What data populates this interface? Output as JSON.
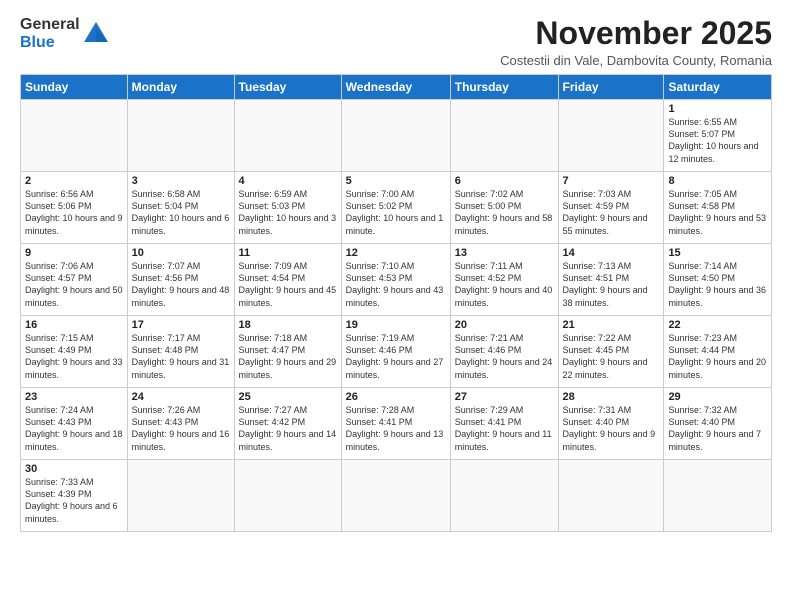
{
  "logo": {
    "text_general": "General",
    "text_blue": "Blue"
  },
  "header": {
    "month_title": "November 2025",
    "subtitle": "Costestii din Vale, Dambovita County, Romania"
  },
  "days_of_week": [
    "Sunday",
    "Monday",
    "Tuesday",
    "Wednesday",
    "Thursday",
    "Friday",
    "Saturday"
  ],
  "weeks": [
    [
      {
        "day": "",
        "info": ""
      },
      {
        "day": "",
        "info": ""
      },
      {
        "day": "",
        "info": ""
      },
      {
        "day": "",
        "info": ""
      },
      {
        "day": "",
        "info": ""
      },
      {
        "day": "",
        "info": ""
      },
      {
        "day": "1",
        "info": "Sunrise: 6:55 AM\nSunset: 5:07 PM\nDaylight: 10 hours and 12 minutes."
      }
    ],
    [
      {
        "day": "2",
        "info": "Sunrise: 6:56 AM\nSunset: 5:06 PM\nDaylight: 10 hours and 9 minutes."
      },
      {
        "day": "3",
        "info": "Sunrise: 6:58 AM\nSunset: 5:04 PM\nDaylight: 10 hours and 6 minutes."
      },
      {
        "day": "4",
        "info": "Sunrise: 6:59 AM\nSunset: 5:03 PM\nDaylight: 10 hours and 3 minutes."
      },
      {
        "day": "5",
        "info": "Sunrise: 7:00 AM\nSunset: 5:02 PM\nDaylight: 10 hours and 1 minute."
      },
      {
        "day": "6",
        "info": "Sunrise: 7:02 AM\nSunset: 5:00 PM\nDaylight: 9 hours and 58 minutes."
      },
      {
        "day": "7",
        "info": "Sunrise: 7:03 AM\nSunset: 4:59 PM\nDaylight: 9 hours and 55 minutes."
      },
      {
        "day": "8",
        "info": "Sunrise: 7:05 AM\nSunset: 4:58 PM\nDaylight: 9 hours and 53 minutes."
      }
    ],
    [
      {
        "day": "9",
        "info": "Sunrise: 7:06 AM\nSunset: 4:57 PM\nDaylight: 9 hours and 50 minutes."
      },
      {
        "day": "10",
        "info": "Sunrise: 7:07 AM\nSunset: 4:56 PM\nDaylight: 9 hours and 48 minutes."
      },
      {
        "day": "11",
        "info": "Sunrise: 7:09 AM\nSunset: 4:54 PM\nDaylight: 9 hours and 45 minutes."
      },
      {
        "day": "12",
        "info": "Sunrise: 7:10 AM\nSunset: 4:53 PM\nDaylight: 9 hours and 43 minutes."
      },
      {
        "day": "13",
        "info": "Sunrise: 7:11 AM\nSunset: 4:52 PM\nDaylight: 9 hours and 40 minutes."
      },
      {
        "day": "14",
        "info": "Sunrise: 7:13 AM\nSunset: 4:51 PM\nDaylight: 9 hours and 38 minutes."
      },
      {
        "day": "15",
        "info": "Sunrise: 7:14 AM\nSunset: 4:50 PM\nDaylight: 9 hours and 36 minutes."
      }
    ],
    [
      {
        "day": "16",
        "info": "Sunrise: 7:15 AM\nSunset: 4:49 PM\nDaylight: 9 hours and 33 minutes."
      },
      {
        "day": "17",
        "info": "Sunrise: 7:17 AM\nSunset: 4:48 PM\nDaylight: 9 hours and 31 minutes."
      },
      {
        "day": "18",
        "info": "Sunrise: 7:18 AM\nSunset: 4:47 PM\nDaylight: 9 hours and 29 minutes."
      },
      {
        "day": "19",
        "info": "Sunrise: 7:19 AM\nSunset: 4:46 PM\nDaylight: 9 hours and 27 minutes."
      },
      {
        "day": "20",
        "info": "Sunrise: 7:21 AM\nSunset: 4:46 PM\nDaylight: 9 hours and 24 minutes."
      },
      {
        "day": "21",
        "info": "Sunrise: 7:22 AM\nSunset: 4:45 PM\nDaylight: 9 hours and 22 minutes."
      },
      {
        "day": "22",
        "info": "Sunrise: 7:23 AM\nSunset: 4:44 PM\nDaylight: 9 hours and 20 minutes."
      }
    ],
    [
      {
        "day": "23",
        "info": "Sunrise: 7:24 AM\nSunset: 4:43 PM\nDaylight: 9 hours and 18 minutes."
      },
      {
        "day": "24",
        "info": "Sunrise: 7:26 AM\nSunset: 4:43 PM\nDaylight: 9 hours and 16 minutes."
      },
      {
        "day": "25",
        "info": "Sunrise: 7:27 AM\nSunset: 4:42 PM\nDaylight: 9 hours and 14 minutes."
      },
      {
        "day": "26",
        "info": "Sunrise: 7:28 AM\nSunset: 4:41 PM\nDaylight: 9 hours and 13 minutes."
      },
      {
        "day": "27",
        "info": "Sunrise: 7:29 AM\nSunset: 4:41 PM\nDaylight: 9 hours and 11 minutes."
      },
      {
        "day": "28",
        "info": "Sunrise: 7:31 AM\nSunset: 4:40 PM\nDaylight: 9 hours and 9 minutes."
      },
      {
        "day": "29",
        "info": "Sunrise: 7:32 AM\nSunset: 4:40 PM\nDaylight: 9 hours and 7 minutes."
      }
    ],
    [
      {
        "day": "30",
        "info": "Sunrise: 7:33 AM\nSunset: 4:39 PM\nDaylight: 9 hours and 6 minutes."
      },
      {
        "day": "",
        "info": ""
      },
      {
        "day": "",
        "info": ""
      },
      {
        "day": "",
        "info": ""
      },
      {
        "day": "",
        "info": ""
      },
      {
        "day": "",
        "info": ""
      },
      {
        "day": "",
        "info": ""
      }
    ]
  ]
}
